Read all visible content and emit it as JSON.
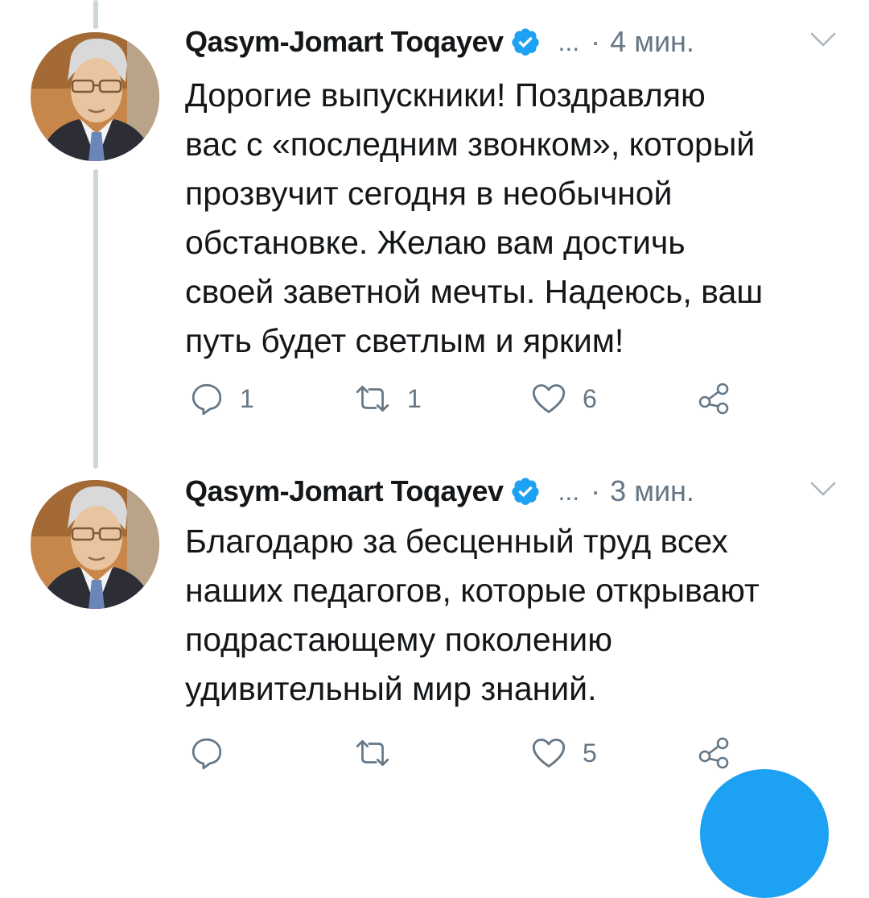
{
  "colors": {
    "accent": "#1da1f2",
    "muted": "#657786",
    "text": "#14171a",
    "thread_line": "#ccd6dd"
  },
  "tweets": [
    {
      "author": "Qasym-Jomart Toqayev",
      "verified": true,
      "more": "...",
      "separator": "·",
      "time": "4 мин.",
      "text_lines": [
        "Дорогие выпускники! Поздравляю",
        "вас с «последним звонком», который",
        "прозвучит сегодня в необычной",
        "обстановке. Желаю вам достичь",
        "своей заветной мечты. Надеюсь, ваш",
        "путь будет светлым и ярким!"
      ],
      "replies": "1",
      "retweets": "1",
      "likes": "6"
    },
    {
      "author": "Qasym-Jomart Toqayev",
      "verified": true,
      "more": "...",
      "separator": "·",
      "time": "3 мин.",
      "text_lines": [
        "Благодарю за бесценный труд всех",
        "наших педагогов, которые открывают",
        "подрастающему поколению",
        "удивительный мир знаний."
      ],
      "replies": "",
      "retweets": "",
      "likes": "5"
    }
  ]
}
